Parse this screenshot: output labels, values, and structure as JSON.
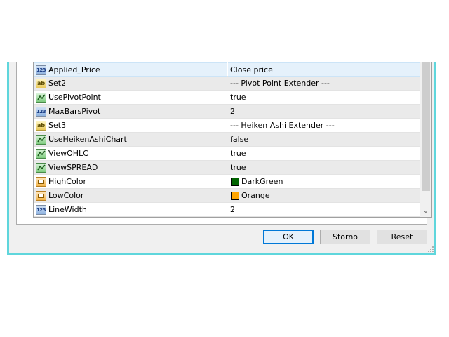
{
  "properties": [
    {
      "name": "Applied_Price",
      "value": "Close price",
      "type": "number",
      "icon": "numeric-icon",
      "selected": true
    },
    {
      "name": "Set2",
      "value": "--- Pivot Point Extender ---",
      "type": "string",
      "icon": "string-icon"
    },
    {
      "name": "UsePivotPoint",
      "value": "true",
      "type": "bool",
      "icon": "boolean-icon"
    },
    {
      "name": "MaxBarsPivot",
      "value": "2",
      "type": "number",
      "icon": "numeric-icon"
    },
    {
      "name": "Set3",
      "value": "--- Heiken Ashi Extender ---",
      "type": "string",
      "icon": "string-icon"
    },
    {
      "name": "UseHeikenAshiChart",
      "value": "false",
      "type": "bool",
      "icon": "boolean-icon"
    },
    {
      "name": "ViewOHLC",
      "value": "true",
      "type": "bool",
      "icon": "boolean-icon"
    },
    {
      "name": "ViewSPREAD",
      "value": "true",
      "type": "bool",
      "icon": "boolean-icon"
    },
    {
      "name": "HighColor",
      "value": "DarkGreen",
      "type": "color",
      "icon": "color-icon",
      "swatch": "#006400"
    },
    {
      "name": "LowColor",
      "value": "Orange",
      "type": "color",
      "icon": "color-icon",
      "swatch": "#ffa500"
    },
    {
      "name": "LineWidth",
      "value": "2",
      "type": "number",
      "icon": "numeric-icon"
    }
  ],
  "buttons": {
    "ok": "OK",
    "storno": "Storno",
    "reset": "Reset"
  },
  "scrollbar": {
    "down_arrow": "⌄"
  },
  "icon_glyphs": {
    "number": "123",
    "string": "ab"
  },
  "colors": {
    "accent": "#0078d7",
    "frame": "#5fd6dc",
    "selection": "#e5f1fb"
  }
}
